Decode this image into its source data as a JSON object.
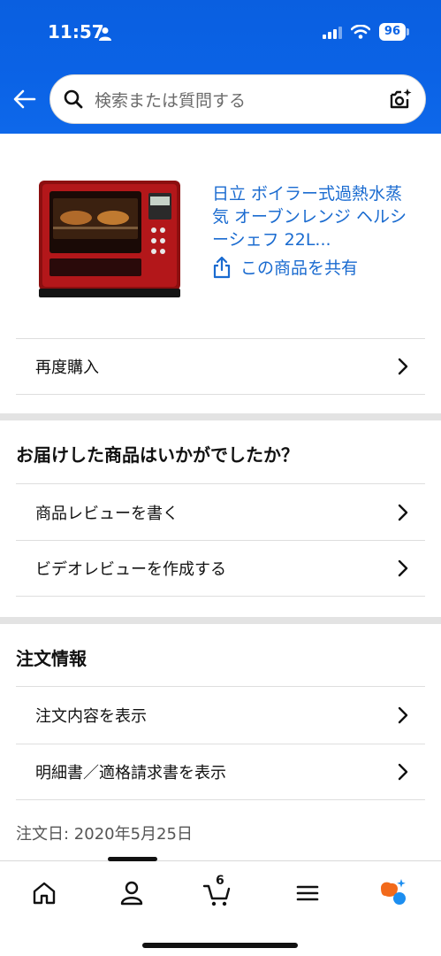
{
  "status_bar": {
    "time": "11:57",
    "battery": "96"
  },
  "search": {
    "placeholder": "検索または質問する"
  },
  "product": {
    "title": "日立 ボイラー式過熱水蒸気 オーブンレンジ ヘルシーシェフ 22L...",
    "share_label": "この商品を共有"
  },
  "actions": {
    "buy_again": "再度購入"
  },
  "review_section": {
    "title": "お届けした商品はいかがでしたか？",
    "items": [
      "商品レビューを書く",
      "ビデオレビューを作成する"
    ]
  },
  "order_section": {
    "title": "注文情報",
    "items": [
      "注文内容を表示",
      "明細書／適格請求書を表示"
    ],
    "order_date": "注文日: 2020年5月25日"
  },
  "bottom_nav": {
    "cart_count": "6"
  },
  "colors": {
    "header": "#0b63e6",
    "link": "#1a6bd0",
    "accent_orange": "#f26a1b",
    "accent_blue": "#1c8ef0"
  }
}
